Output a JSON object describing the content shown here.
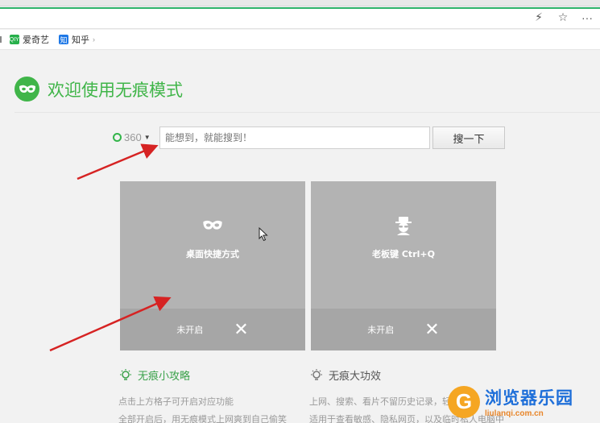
{
  "bookmarks": [
    {
      "label": "爱奇艺",
      "icon": "iqiyi-icon",
      "badge": "iQIYI"
    },
    {
      "label": "知乎",
      "icon": "zhihu-icon",
      "badge": "知"
    }
  ],
  "toolbar": {
    "bolt_icon": "⚡",
    "star_icon": "☆",
    "more_icon": "···"
  },
  "header": {
    "title": "欢迎使用无痕模式"
  },
  "search": {
    "engine": "360",
    "placeholder": "能想到，就能搜到！",
    "button_label": "搜一下"
  },
  "tiles": [
    {
      "label": "桌面快捷方式",
      "status": "未开启",
      "icon": "mask-icon"
    },
    {
      "label": "老板键 Ctrl+Q",
      "status": "未开启",
      "icon": "boss-icon"
    }
  ],
  "tips": {
    "left": {
      "title": "无痕小攻略",
      "lines": [
        "点击上方格子可开启对应功能",
        "全部开启后，用无痕模式上网爽到自己偷笑"
      ]
    },
    "right": {
      "title": "无痕大功效",
      "lines": [
        "上网、搜索、看片不留历史记录，轻松",
        "适用于查看敏感、隐私网页，以及临时私人电脑中"
      ]
    }
  },
  "watermark": {
    "name": "浏览器乐园",
    "url": "liulanqi.com.cn"
  },
  "colors": {
    "brand_green": "#40b549",
    "tile_gray": "#b3b3b3",
    "tile_bottom_gray": "#a6a6a6",
    "arrow_red": "#d62323"
  }
}
